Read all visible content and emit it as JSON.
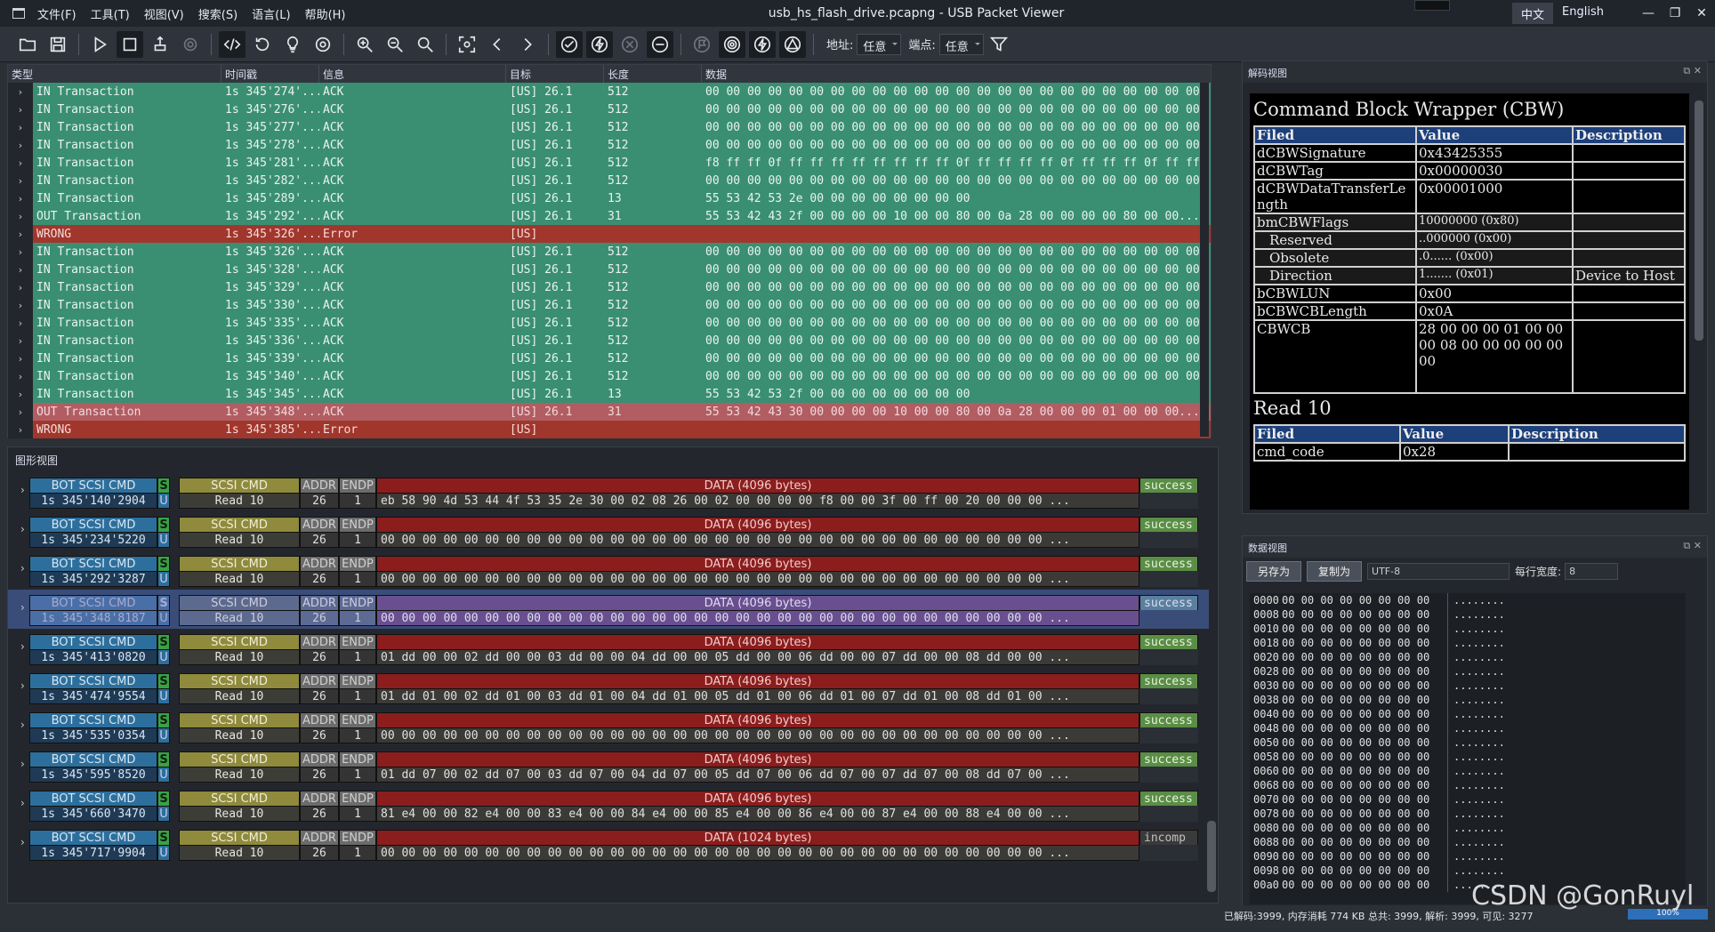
{
  "titlebar": {
    "menus": [
      "文件(F)",
      "工具(T)",
      "视图(V)",
      "搜索(S)",
      "语言(L)",
      "帮助(H)"
    ],
    "title": "usb_hs_flash_drive.pcapng - USB Packet Viewer",
    "lang_cn": "中文",
    "lang_en": "English"
  },
  "toolbar": {
    "addr_label": "地址:",
    "addr_value": "任意",
    "endpoint_label": "端点:",
    "endpoint_value": "任意"
  },
  "packets": {
    "headers": [
      "类型",
      "时间戳",
      "信息",
      "目标",
      "长度",
      "数据"
    ],
    "rows": [
      {
        "style": "in",
        "type": "IN Transaction",
        "time": "1s 345'274'...",
        "info": "ACK",
        "target": "[US] 26.1",
        "len": "512",
        "data": "00 00 00 00 00 00 00 00 00 00 00 00 00 00 00 00 00 00 00 00 00 00 00 00..."
      },
      {
        "style": "in",
        "type": "IN Transaction",
        "time": "1s 345'276'...",
        "info": "ACK",
        "target": "[US] 26.1",
        "len": "512",
        "data": "00 00 00 00 00 00 00 00 00 00 00 00 00 00 00 00 00 00 00 00 00 00 00 00..."
      },
      {
        "style": "in",
        "type": "IN Transaction",
        "time": "1s 345'277'...",
        "info": "ACK",
        "target": "[US] 26.1",
        "len": "512",
        "data": "00 00 00 00 00 00 00 00 00 00 00 00 00 00 00 00 00 00 00 00 00 00 00 00..."
      },
      {
        "style": "in",
        "type": "IN Transaction",
        "time": "1s 345'278'...",
        "info": "ACK",
        "target": "[US] 26.1",
        "len": "512",
        "data": "00 00 00 00 00 00 00 00 00 00 00 00 00 00 00 00 00 00 00 00 00 00 00 00..."
      },
      {
        "style": "in",
        "type": "IN Transaction",
        "time": "1s 345'281'...",
        "info": "ACK",
        "target": "[US] 26.1",
        "len": "512",
        "data": "f8 ff ff 0f ff ff ff ff ff ff ff ff 0f ff ff ff ff 0f ff ff ff 0f ff ff ff..."
      },
      {
        "style": "in",
        "type": "IN Transaction",
        "time": "1s 345'282'...",
        "info": "ACK",
        "target": "[US] 26.1",
        "len": "512",
        "data": "00 00 00 00 00 00 00 00 00 00 00 00 00 00 00 00 00 00 00 00 00 00 00 00..."
      },
      {
        "style": "in",
        "type": "IN Transaction",
        "time": "1s 345'289'...",
        "info": "ACK",
        "target": "[US] 26.1",
        "len": "13",
        "data": "55 53 42 53 2e 00 00 00 00 00 00 00 00"
      },
      {
        "style": "in",
        "type": "OUT Transaction",
        "time": "1s 345'292'...",
        "info": "ACK",
        "target": "[US] 26.1",
        "len": "31",
        "data": "55 53 42 43 2f 00 00 00 00 10 00 00 80 00 0a 28 00 00 00 00 80 00 00..."
      },
      {
        "style": "wrong",
        "type": "WRONG",
        "time": "1s 345'326'...",
        "info": "Error",
        "target": "[US]",
        "len": "",
        "data": ""
      },
      {
        "style": "in",
        "type": "IN Transaction",
        "time": "1s 345'326'...",
        "info": "ACK",
        "target": "[US] 26.1",
        "len": "512",
        "data": "00 00 00 00 00 00 00 00 00 00 00 00 00 00 00 00 00 00 00 00 00 00 00 00..."
      },
      {
        "style": "in",
        "type": "IN Transaction",
        "time": "1s 345'328'...",
        "info": "ACK",
        "target": "[US] 26.1",
        "len": "512",
        "data": "00 00 00 00 00 00 00 00 00 00 00 00 00 00 00 00 00 00 00 00 00 00 00 00..."
      },
      {
        "style": "in",
        "type": "IN Transaction",
        "time": "1s 345'329'...",
        "info": "ACK",
        "target": "[US] 26.1",
        "len": "512",
        "data": "00 00 00 00 00 00 00 00 00 00 00 00 00 00 00 00 00 00 00 00 00 00 00 00..."
      },
      {
        "style": "in",
        "type": "IN Transaction",
        "time": "1s 345'330'...",
        "info": "ACK",
        "target": "[US] 26.1",
        "len": "512",
        "data": "00 00 00 00 00 00 00 00 00 00 00 00 00 00 00 00 00 00 00 00 00 00 00 00..."
      },
      {
        "style": "in",
        "type": "IN Transaction",
        "time": "1s 345'335'...",
        "info": "ACK",
        "target": "[US] 26.1",
        "len": "512",
        "data": "00 00 00 00 00 00 00 00 00 00 00 00 00 00 00 00 00 00 00 00 00 00 00 00..."
      },
      {
        "style": "in",
        "type": "IN Transaction",
        "time": "1s 345'336'...",
        "info": "ACK",
        "target": "[US] 26.1",
        "len": "512",
        "data": "00 00 00 00 00 00 00 00 00 00 00 00 00 00 00 00 00 00 00 00 00 00 00 00..."
      },
      {
        "style": "in",
        "type": "IN Transaction",
        "time": "1s 345'339'...",
        "info": "ACK",
        "target": "[US] 26.1",
        "len": "512",
        "data": "00 00 00 00 00 00 00 00 00 00 00 00 00 00 00 00 00 00 00 00 00 00 00 00..."
      },
      {
        "style": "in",
        "type": "IN Transaction",
        "time": "1s 345'340'...",
        "info": "ACK",
        "target": "[US] 26.1",
        "len": "512",
        "data": "00 00 00 00 00 00 00 00 00 00 00 00 00 00 00 00 00 00 00 00 00 00 00 00..."
      },
      {
        "style": "in",
        "type": "IN Transaction",
        "time": "1s 345'345'...",
        "info": "ACK",
        "target": "[US] 26.1",
        "len": "13",
        "data": "55 53 42 53 2f 00 00 00 00 00 00 00 00"
      },
      {
        "style": "outsel",
        "type": "OUT Transaction",
        "time": "1s 345'348'...",
        "info": "ACK",
        "target": "[US] 26.1",
        "len": "31",
        "data": "55 53 42 43 30 00 00 00 00 10 00 00 80 00 0a 28 00 00 00 01 00 00 00..."
      },
      {
        "style": "wrong",
        "type": "WRONG",
        "time": "1s 345'385'...",
        "info": "Error",
        "target": "[US]",
        "len": "",
        "data": ""
      }
    ]
  },
  "graph": {
    "title": "图形视图",
    "rows": [
      {
        "sel": false,
        "bot": "BOT SCSI CMD",
        "time": "1s 345'140'2904",
        "s": "S",
        "u": "U",
        "scsi": "SCSI CMD",
        "cmd": "Read 10",
        "addr_h": "ADDR",
        "addr": "26",
        "endp_h": "ENDP",
        "endp": "1",
        "data_h": "DATA (4096 bytes)",
        "data": "eb 58 90 4d 53 44 4f 53 35 2e 30 00 02 08 26 00 02 00 00 00 00 f8 00 00 3f 00 ff 00 20 00 00 00 ...",
        "status": "success"
      },
      {
        "sel": false,
        "bot": "BOT SCSI CMD",
        "time": "1s 345'234'5220",
        "s": "S",
        "u": "U",
        "scsi": "SCSI CMD",
        "cmd": "Read 10",
        "addr_h": "ADDR",
        "addr": "26",
        "endp_h": "ENDP",
        "endp": "1",
        "data_h": "DATA (4096 bytes)",
        "data": "00 00 00 00 00 00 00 00 00 00 00 00 00 00 00 00 00 00 00 00 00 00 00 00 00 00 00 00 00 00 00 00 ...",
        "status": "success"
      },
      {
        "sel": false,
        "bot": "BOT SCSI CMD",
        "time": "1s 345'292'3287",
        "s": "S",
        "u": "U",
        "scsi": "SCSI CMD",
        "cmd": "Read 10",
        "addr_h": "ADDR",
        "addr": "26",
        "endp_h": "ENDP",
        "endp": "1",
        "data_h": "DATA (4096 bytes)",
        "data": "00 00 00 00 00 00 00 00 00 00 00 00 00 00 00 00 00 00 00 00 00 00 00 00 00 00 00 00 00 00 00 00 ...",
        "status": "success"
      },
      {
        "sel": true,
        "bot": "BOT SCSI CMD",
        "time": "1s 345'348'8187",
        "s": "S",
        "u": "U",
        "scsi": "SCSI CMD",
        "cmd": "Read 10",
        "addr_h": "ADDR",
        "addr": "26",
        "endp_h": "ENDP",
        "endp": "1",
        "data_h": "DATA (4096 bytes)",
        "data": "00 00 00 00 00 00 00 00 00 00 00 00 00 00 00 00 00 00 00 00 00 00 00 00 00 00 00 00 00 00 00 00 ...",
        "status": "success"
      },
      {
        "sel": false,
        "bot": "BOT SCSI CMD",
        "time": "1s 345'413'0820",
        "s": "S",
        "u": "U",
        "scsi": "SCSI CMD",
        "cmd": "Read 10",
        "addr_h": "ADDR",
        "addr": "26",
        "endp_h": "ENDP",
        "endp": "1",
        "data_h": "DATA (4096 bytes)",
        "data": "01 dd 00 00 02 dd 00 00 03 dd 00 00 04 dd 00 00 05 dd 00 00 06 dd 00 00 07 dd 00 00 08 dd 00 00 ...",
        "status": "success"
      },
      {
        "sel": false,
        "bot": "BOT SCSI CMD",
        "time": "1s 345'474'9554",
        "s": "S",
        "u": "U",
        "scsi": "SCSI CMD",
        "cmd": "Read 10",
        "addr_h": "ADDR",
        "addr": "26",
        "endp_h": "ENDP",
        "endp": "1",
        "data_h": "DATA (4096 bytes)",
        "data": "01 dd 01 00 02 dd 01 00 03 dd 01 00 04 dd 01 00 05 dd 01 00 06 dd 01 00 07 dd 01 00 08 dd 01 00 ...",
        "status": "success"
      },
      {
        "sel": false,
        "bot": "BOT SCSI CMD",
        "time": "1s 345'535'0354",
        "s": "S",
        "u": "U",
        "scsi": "SCSI CMD",
        "cmd": "Read 10",
        "addr_h": "ADDR",
        "addr": "26",
        "endp_h": "ENDP",
        "endp": "1",
        "data_h": "DATA (4096 bytes)",
        "data": "00 00 00 00 00 00 00 00 00 00 00 00 00 00 00 00 00 00 00 00 00 00 00 00 00 00 00 00 00 00 00 00 ...",
        "status": "success"
      },
      {
        "sel": false,
        "bot": "BOT SCSI CMD",
        "time": "1s 345'595'8520",
        "s": "S",
        "u": "U",
        "scsi": "SCSI CMD",
        "cmd": "Read 10",
        "addr_h": "ADDR",
        "addr": "26",
        "endp_h": "ENDP",
        "endp": "1",
        "data_h": "DATA (4096 bytes)",
        "data": "01 dd 07 00 02 dd 07 00 03 dd 07 00 04 dd 07 00 05 dd 07 00 06 dd 07 00 07 dd 07 00 08 dd 07 00 ...",
        "status": "success"
      },
      {
        "sel": false,
        "bot": "BOT SCSI CMD",
        "time": "1s 345'660'3470",
        "s": "S",
        "u": "U",
        "scsi": "SCSI CMD",
        "cmd": "Read 10",
        "addr_h": "ADDR",
        "addr": "26",
        "endp_h": "ENDP",
        "endp": "1",
        "data_h": "DATA (4096 bytes)",
        "data": "81 e4 00 00 82 e4 00 00 83 e4 00 00 84 e4 00 00 85 e4 00 00 86 e4 00 00 87 e4 00 00 88 e4 00 00 ...",
        "status": "success"
      },
      {
        "sel": false,
        "bot": "BOT SCSI CMD",
        "time": "1s 345'717'9904",
        "s": "S",
        "u": "U",
        "scsi": "SCSI CMD",
        "cmd": "Read 10",
        "addr_h": "ADDR",
        "addr": "26",
        "endp_h": "ENDP",
        "endp": "1",
        "data_h": "DATA (1024 bytes)",
        "data": "00 00 00 00 00 00 00 00 00 00 00 00 00 00 00 00 00 00 00 00 00 00 00 00 00 00 00 00 00 00 00 00 ...",
        "status": "incomp"
      }
    ]
  },
  "decode": {
    "title": "解码视图",
    "cbw_title": "Command Block Wrapper (CBW)",
    "headers": [
      "Filed",
      "Value",
      "Description"
    ],
    "rows": [
      {
        "f": "dCBWSignature",
        "v": "0x43425355",
        "d": "",
        "bit": false,
        "sub": false
      },
      {
        "f": "dCBWTag",
        "v": "0x00000030",
        "d": "",
        "bit": false,
        "sub": false
      },
      {
        "f": "dCBWDataTransferLength",
        "v": "0x00001000",
        "d": "",
        "bit": false,
        "sub": false
      },
      {
        "f": "bmCBWFlags",
        "v": "10000000 (0x80)",
        "d": "",
        "bit": true,
        "sub": false
      },
      {
        "f": "Reserved",
        "v": "..000000 (0x00)",
        "d": "",
        "bit": true,
        "sub": true
      },
      {
        "f": "Obsolete",
        "v": ".0...... (0x00)",
        "d": "",
        "bit": true,
        "sub": true
      },
      {
        "f": "Direction",
        "v": "1....... (0x01)",
        "d": "Device to Host",
        "bit": true,
        "sub": true
      },
      {
        "f": "bCBWLUN",
        "v": "0x00",
        "d": "",
        "bit": false,
        "sub": false
      },
      {
        "f": "bCBWCBLength",
        "v": "0x0A",
        "d": "",
        "bit": false,
        "sub": false
      },
      {
        "f": "CBWCB",
        "v": "28 00 00 00 01 00 00 00 08 00 00 00 00 00 00",
        "d": "",
        "bit": false,
        "sub": false
      }
    ],
    "read_title": "Read 10",
    "read_headers": [
      "Filed",
      "Value",
      "Description"
    ],
    "read_row": {
      "f": "cmd_code",
      "v": "0x28",
      "d": ""
    }
  },
  "dataview": {
    "title": "数据视图",
    "save_as": "另存为",
    "copy_as": "复制为",
    "encoding": "UTF-8",
    "width_label": "每行宽度:",
    "width_value": "8",
    "addrs": [
      "0000",
      "0008",
      "0010",
      "0018",
      "0020",
      "0028",
      "0030",
      "0038",
      "0040",
      "0048",
      "0050",
      "0058",
      "0060",
      "0068",
      "0070",
      "0078",
      "0080",
      "0088",
      "0090",
      "0098",
      "00a0"
    ],
    "bytes": "00 00 00 00 00 00 00 00",
    "ascii": "........"
  },
  "status": {
    "text": "已解码:3999, 内存消耗 774 KB    总共: 3999, 解析: 3999, 可见: 3277",
    "zoom": "100%"
  },
  "watermark": "CSDN @GonRuyl"
}
